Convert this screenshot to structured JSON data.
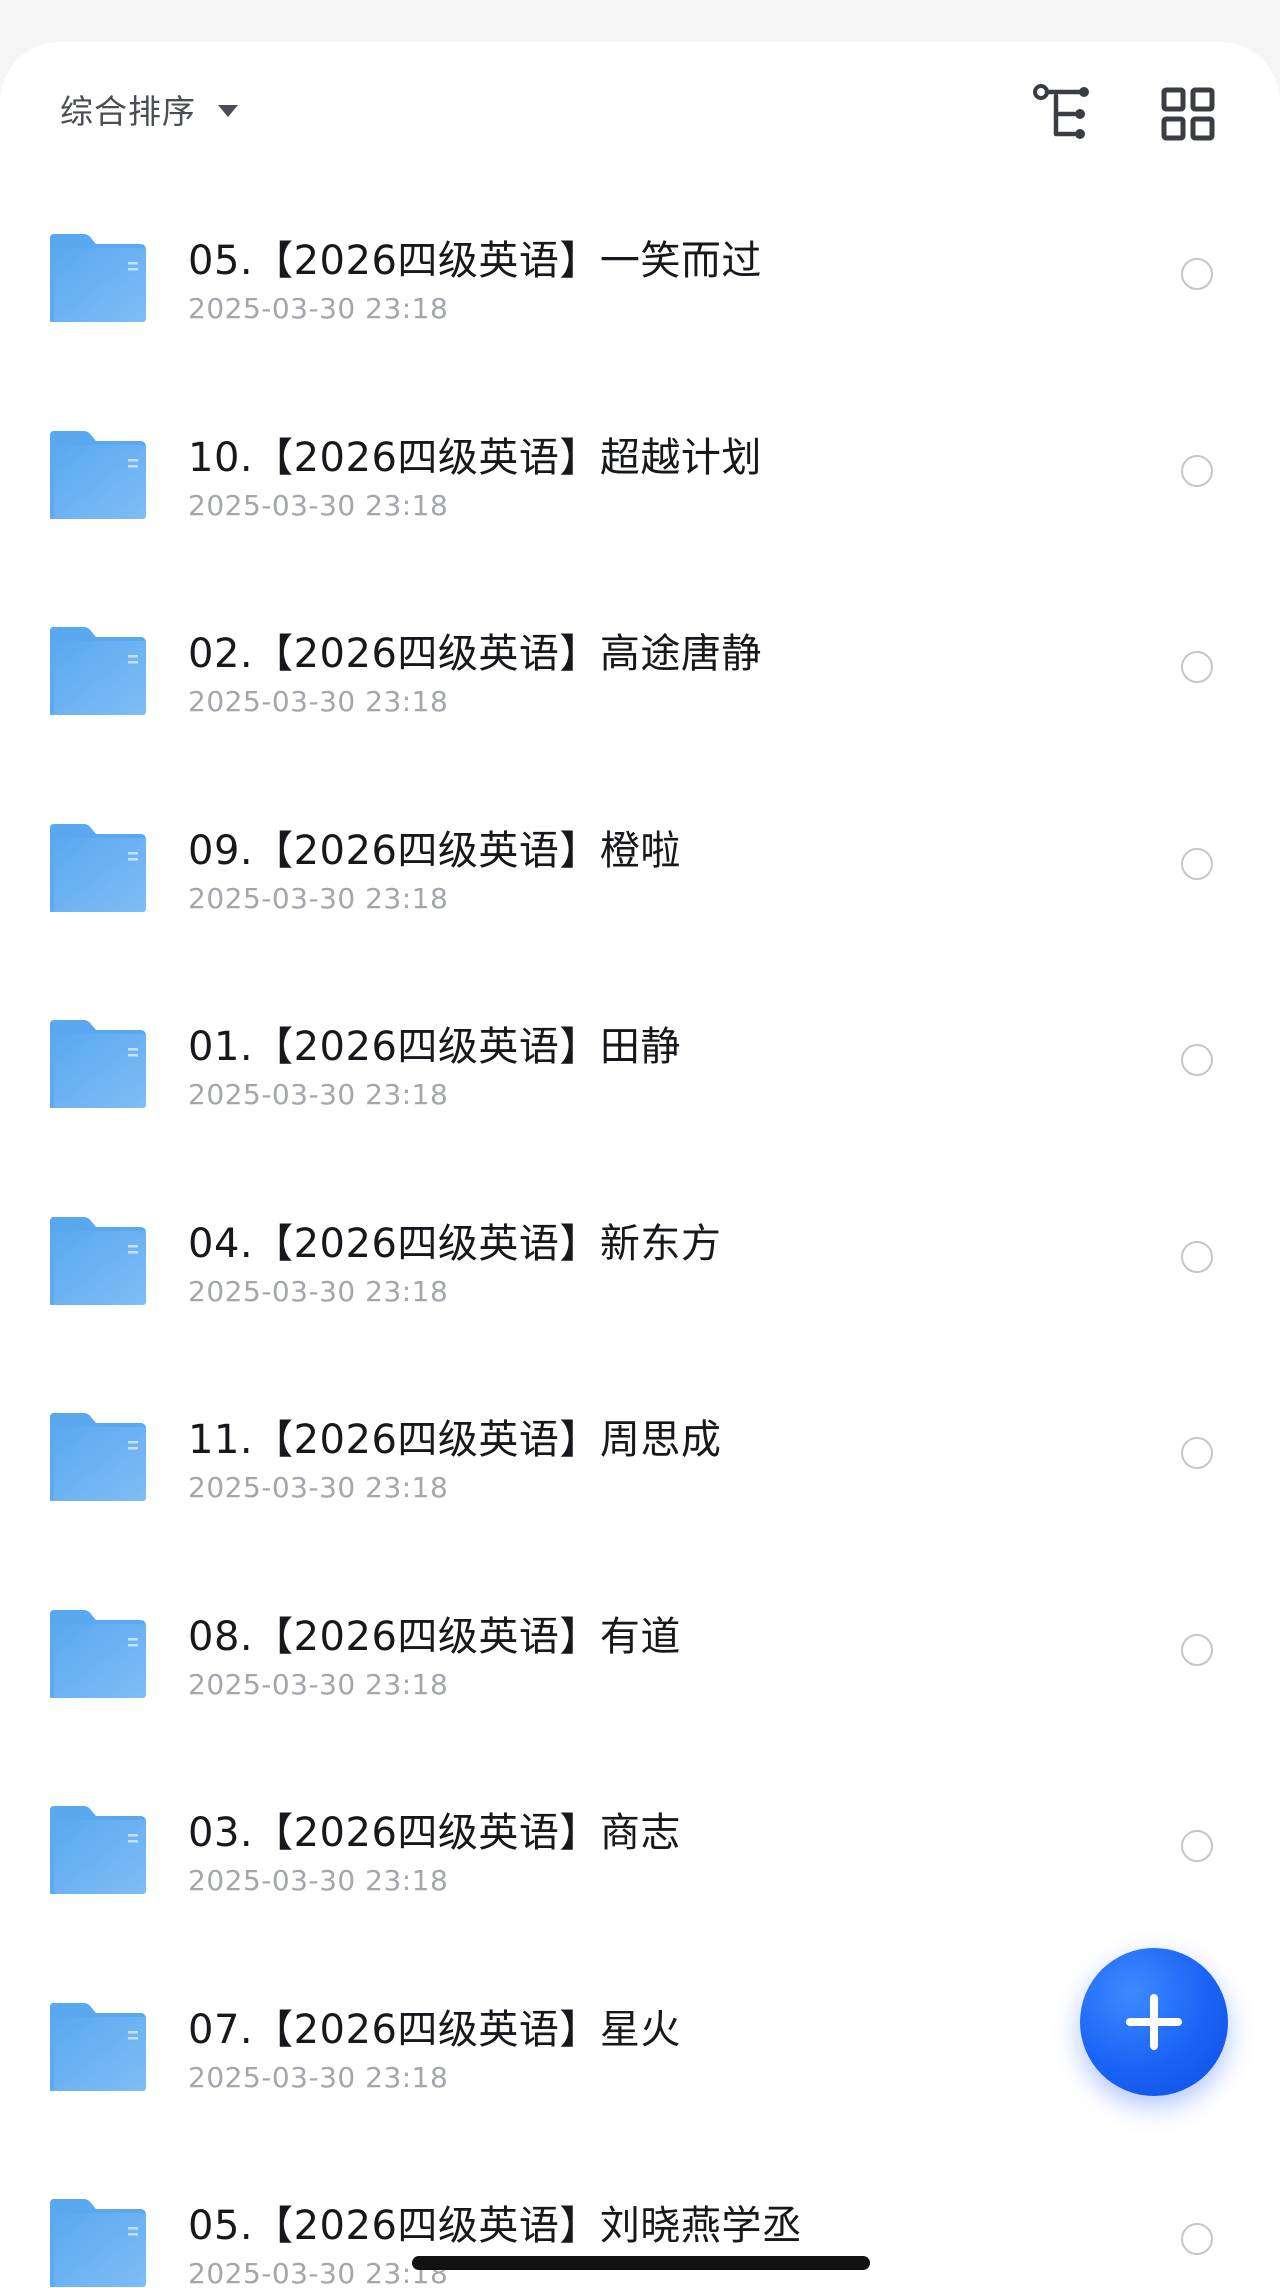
{
  "toolbar": {
    "sort_label": "综合排序",
    "sort_icon": "caret-down-icon",
    "tree_view_icon": "tree-view-icon",
    "grid_view_icon": "grid-view-icon"
  },
  "colors": {
    "folder_top": "#7fbdf5",
    "folder_bottom": "#5aa8f0",
    "fab_blue": "#1a62f5",
    "title_text": "#16181d",
    "time_text": "#a3a6ad"
  },
  "files": [
    {
      "name": "05.【2026四级英语】一笑而过",
      "time": "2025-03-30 23:18",
      "icon": "folder-icon"
    },
    {
      "name": "10.【2026四级英语】超越计划",
      "time": "2025-03-30 23:18",
      "icon": "folder-icon"
    },
    {
      "name": "02.【2026四级英语】高途唐静",
      "time": "2025-03-30 23:18",
      "icon": "folder-icon"
    },
    {
      "name": "09.【2026四级英语】橙啦",
      "time": "2025-03-30 23:18",
      "icon": "folder-icon"
    },
    {
      "name": "01.【2026四级英语】田静",
      "time": "2025-03-30 23:18",
      "icon": "folder-icon"
    },
    {
      "name": "04.【2026四级英语】新东方",
      "time": "2025-03-30 23:18",
      "icon": "folder-icon"
    },
    {
      "name": "11.【2026四级英语】周思成",
      "time": "2025-03-30 23:18",
      "icon": "folder-icon"
    },
    {
      "name": "08.【2026四级英语】有道",
      "time": "2025-03-30 23:18",
      "icon": "folder-icon"
    },
    {
      "name": "03.【2026四级英语】商志",
      "time": "2025-03-30 23:18",
      "icon": "folder-icon"
    },
    {
      "name": "07.【2026四级英语】星火",
      "time": "2025-03-30 23:18",
      "icon": "folder-icon"
    },
    {
      "name": "05.【2026四级英语】刘晓燕学丞",
      "time": "2025-03-30 23:18",
      "icon": "folder-icon"
    }
  ],
  "fab": {
    "icon": "plus-icon"
  }
}
